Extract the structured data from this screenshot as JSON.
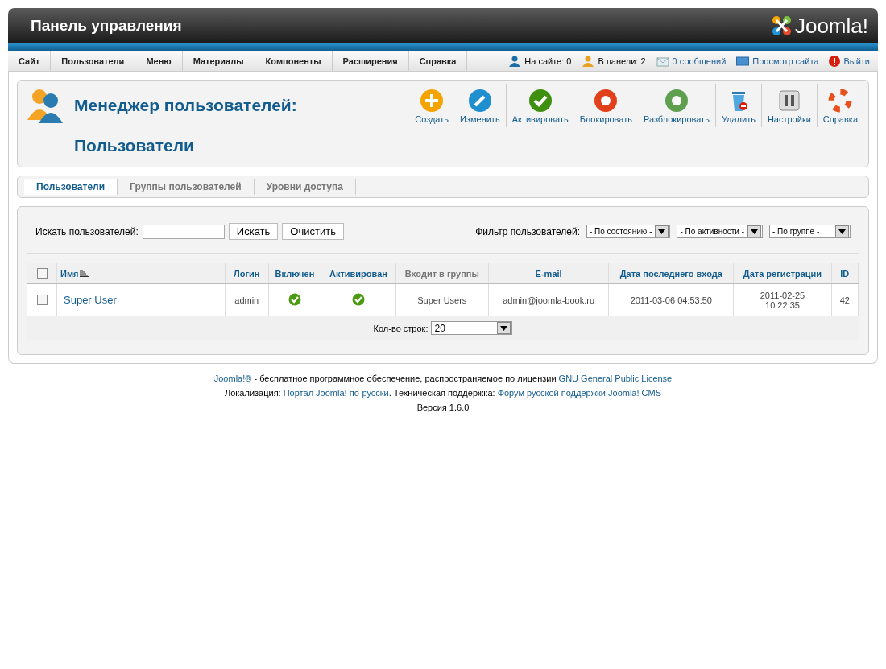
{
  "header": {
    "title": "Панель управления",
    "logo_text": "Joomla!"
  },
  "menu": [
    {
      "label": "Сайт"
    },
    {
      "label": "Пользователи"
    },
    {
      "label": "Меню"
    },
    {
      "label": "Материалы"
    },
    {
      "label": "Компоненты"
    },
    {
      "label": "Расширения"
    },
    {
      "label": "Справка"
    }
  ],
  "status": [
    {
      "kind": "users",
      "label": "На сайте: 0",
      "link": false
    },
    {
      "kind": "admins",
      "label": "В панели: 2",
      "link": false
    },
    {
      "kind": "messages",
      "label": "0 сообщений",
      "link": true
    },
    {
      "kind": "preview",
      "label": "Просмотр сайта",
      "link": true
    },
    {
      "kind": "logout",
      "label": "Выйти",
      "link": true
    }
  ],
  "page_title": {
    "line_1": "Менеджер пользователей:",
    "line_2": "Пользователи"
  },
  "toolbar": [
    [
      {
        "kind": "new",
        "label": "Создать"
      },
      {
        "kind": "edit",
        "label": "Изменить"
      }
    ],
    [
      {
        "kind": "activate",
        "label": "Активировать"
      },
      {
        "kind": "block",
        "label": "Блокировать"
      },
      {
        "kind": "unblock",
        "label": "Разблокировать"
      }
    ],
    [
      {
        "kind": "delete",
        "label": "Удалить"
      }
    ],
    [
      {
        "kind": "options",
        "label": "Настройки"
      }
    ],
    [
      {
        "kind": "help",
        "label": "Справка"
      }
    ]
  ],
  "subtabs": [
    {
      "label": "Пользователи",
      "selected": true
    },
    {
      "label": "Группы пользователей",
      "selected": false
    },
    {
      "label": "Уровни доступа",
      "selected": false
    }
  ],
  "search": {
    "label": "Искать пользователей:",
    "search_button": "Искать",
    "clear_button": "Очистить"
  },
  "filter": {
    "label": "Фильтр пользователей:",
    "selects": [
      "- По состоянию -",
      "- По активности -",
      "- По группе -"
    ]
  },
  "table": {
    "select_all_checked": false,
    "columns": [
      {
        "label": "Имя",
        "link": true,
        "sorted": true
      },
      {
        "label": "Логин",
        "link": true,
        "sorted": false
      },
      {
        "label": "Включен",
        "link": true,
        "sorted": false
      },
      {
        "label": "Активирован",
        "link": true,
        "sorted": false
      },
      {
        "label": "Входит в группы",
        "link": false,
        "sorted": false
      },
      {
        "label": "E-mail",
        "link": true,
        "sorted": false
      },
      {
        "label": "Дата последнего входа",
        "link": true,
        "sorted": false
      },
      {
        "label": "Дата регистрации",
        "link": true,
        "sorted": false
      },
      {
        "label": "ID",
        "link": true,
        "sorted": false
      }
    ],
    "rows": [
      {
        "checked": false,
        "name": "Super User",
        "login": "admin",
        "enabled": true,
        "activated": true,
        "groups": "Super Users",
        "email": "admin@joomla-book.ru",
        "last_visit": "2011-03-06 04:53:50",
        "registered": [
          "2011-02-25",
          "10:22:35"
        ],
        "id": "42"
      }
    ]
  },
  "pagination": {
    "label": "Кол-во строк:",
    "value": "20"
  },
  "footer": [
    [
      {
        "kind": "link",
        "text": "Joomla!®"
      },
      {
        "kind": "text",
        "text": " - бесплатное программное обеспечение, распространяемое по лицензии "
      },
      {
        "kind": "link",
        "text": "GNU General Public License"
      }
    ],
    [
      {
        "kind": "text",
        "text": "Локализация: "
      },
      {
        "kind": "link",
        "text": "Портал Joomla! по-русски"
      },
      {
        "kind": "text",
        "text": ". Техническая поддержка: "
      },
      {
        "kind": "link",
        "text": "Форум русской поддержки Joomla! CMS"
      }
    ],
    [
      {
        "kind": "text",
        "text": "Версия 1.6.0"
      }
    ]
  ]
}
